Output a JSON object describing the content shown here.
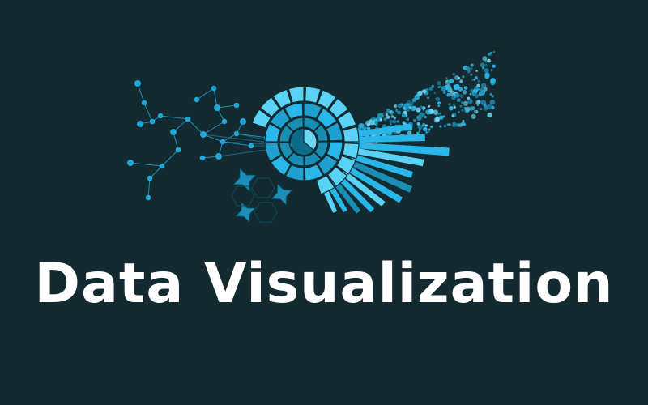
{
  "banner": {
    "title": "Data Visualization",
    "background_color": "#132a30",
    "text_color": "#ffffff",
    "accent_colors": [
      "#29b6e8",
      "#5ad2f5",
      "#1a8db3",
      "#0d6b8a"
    ]
  },
  "illustration": {
    "elements": [
      "network-graph-icon",
      "sunburst-chart-icon",
      "radial-bar-chart-icon",
      "scatter-cloud-icon",
      "star-shapes-icon"
    ]
  }
}
